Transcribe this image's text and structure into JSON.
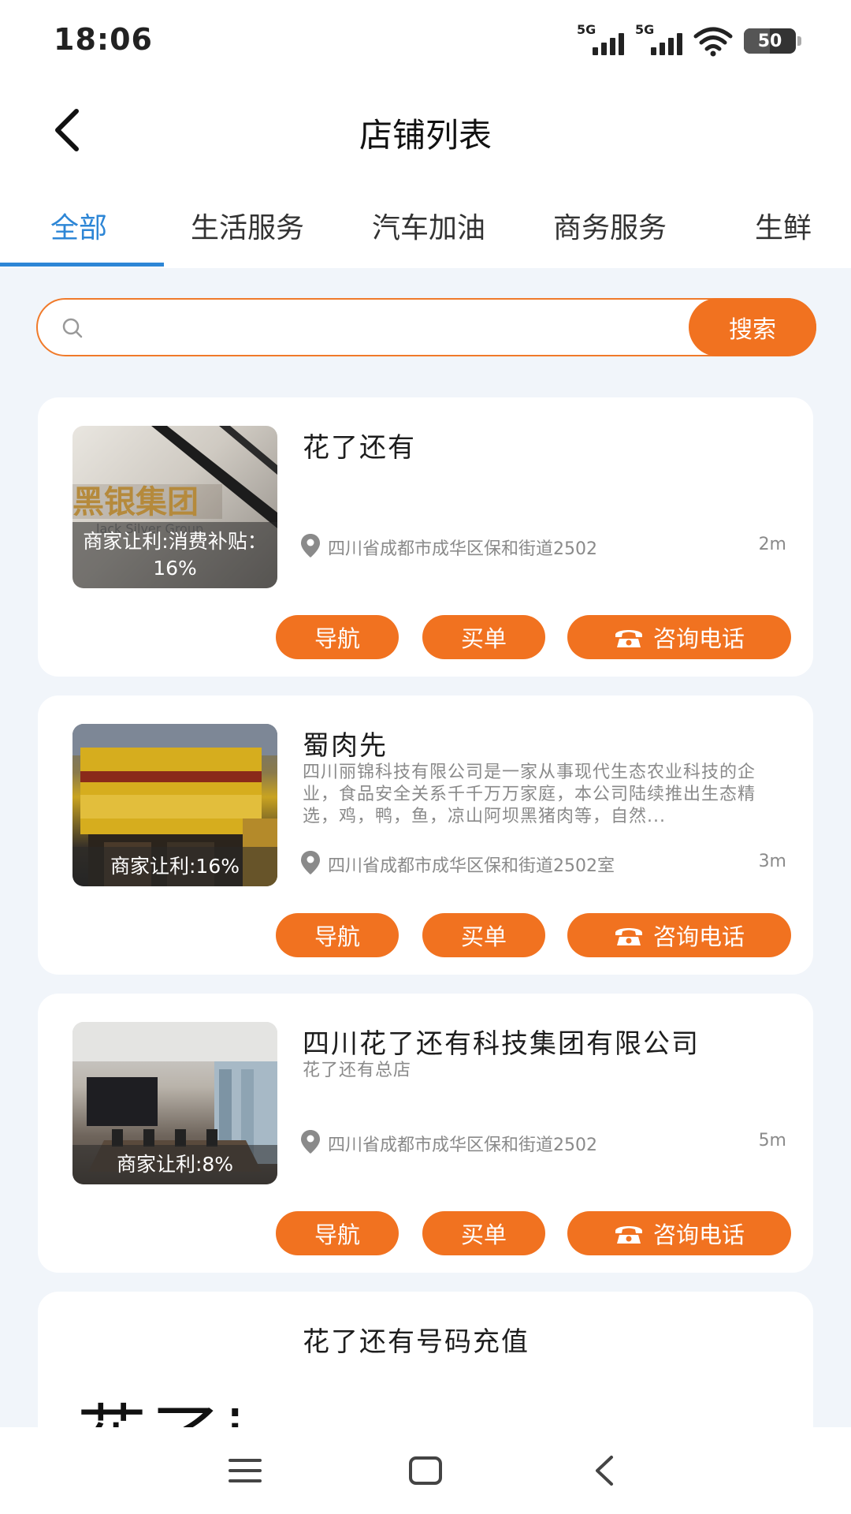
{
  "status_bar": {
    "time": "18:06",
    "signal1": "5G",
    "signal2": "5G",
    "battery": "50"
  },
  "header": {
    "title": "店铺列表"
  },
  "tabs": [
    {
      "label": "全部",
      "active": true
    },
    {
      "label": "生活服务",
      "active": false
    },
    {
      "label": "汽车加油",
      "active": false
    },
    {
      "label": "商务服务",
      "active": false
    },
    {
      "label": "生鲜",
      "active": false
    }
  ],
  "search": {
    "placeholder": "",
    "button_label": "搜索"
  },
  "shops": [
    {
      "name": "花了还有",
      "description": "",
      "thumb_caption": "商家让利:消费补贴：16%",
      "address": "四川省成都市成华区保和街道2502",
      "distance": "2m"
    },
    {
      "name": "蜀肉先",
      "description": "四川丽锦科技有限公司是一家从事现代生态农业科技的企业，食品安全关系千千万万家庭，本公司陆续推出生态精选，鸡，鸭，鱼，凉山阿坝黑猪肉等，自然...",
      "thumb_caption": "商家让利:16%",
      "address": "四川省成都市成华区保和街道2502室",
      "distance": "3m"
    },
    {
      "name": "四川花了还有科技集团有限公司",
      "description": "花了还有总店",
      "thumb_caption": "商家让利:8%",
      "address": "四川省成都市成华区保和街道2502",
      "distance": "5m"
    },
    {
      "name": "花了还有号码充值",
      "description": "",
      "thumb_caption": "",
      "thumb_text": "花了i",
      "address": "",
      "distance": ""
    }
  ],
  "actions": {
    "navigate": "导航",
    "pay": "买单",
    "call": "咨询电话"
  },
  "colors": {
    "accent": "#f17220",
    "tab_active": "#2d86d6",
    "background": "#f1f5fa"
  },
  "icons": [
    "back-arrow-icon",
    "search-icon",
    "location-pin-icon",
    "phone-icon",
    "menu-icon",
    "home-icon",
    "back-icon"
  ]
}
